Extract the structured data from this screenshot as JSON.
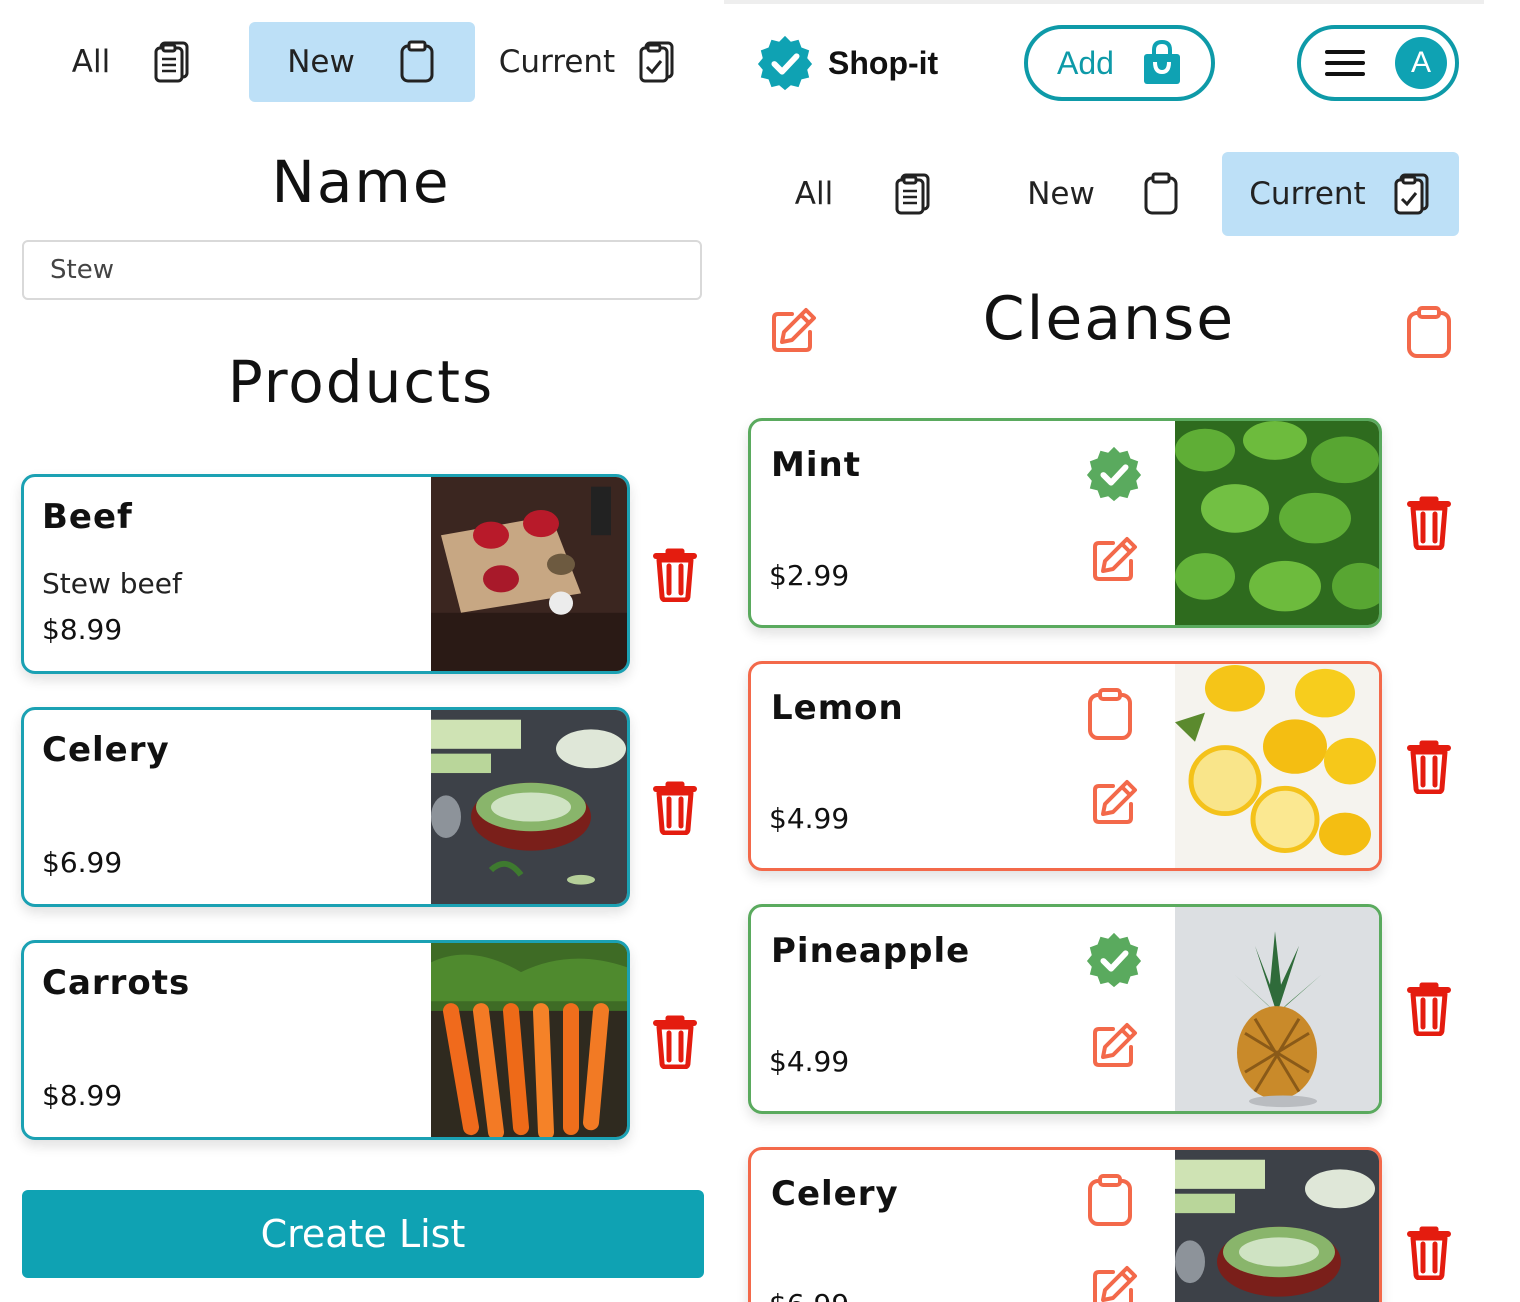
{
  "left": {
    "tabs": [
      {
        "label": "All",
        "icon": "clipboard-list-icon",
        "active": false
      },
      {
        "label": "New",
        "icon": "clipboard-icon",
        "active": true
      },
      {
        "label": "Current",
        "icon": "clipboard-check-icon",
        "active": false
      }
    ],
    "name_heading": "Name",
    "name_value": "Stew",
    "products_heading": "Products",
    "products": [
      {
        "title": "Beef",
        "description": "Stew beef",
        "price": "$8.99"
      },
      {
        "title": "Celery",
        "description": "",
        "price": "$6.99"
      },
      {
        "title": "Carrots",
        "description": "",
        "price": "$8.99"
      }
    ],
    "create_button": "Create List"
  },
  "right": {
    "brand": "Shop-it",
    "add_button": "Add",
    "avatar_letter": "A",
    "tabs": [
      {
        "label": "All",
        "icon": "clipboard-list-icon",
        "active": false
      },
      {
        "label": "New",
        "icon": "clipboard-icon",
        "active": false
      },
      {
        "label": "Current",
        "icon": "clipboard-check-icon",
        "active": true
      }
    ],
    "list_title": "Cleanse",
    "items": [
      {
        "title": "Mint",
        "price": "$2.99",
        "status": "checked"
      },
      {
        "title": "Lemon",
        "price": "$4.99",
        "status": "unchecked"
      },
      {
        "title": "Pineapple",
        "price": "$4.99",
        "status": "checked"
      },
      {
        "title": "Celery",
        "price": "$6.99",
        "status": "unchecked"
      }
    ]
  },
  "colors": {
    "teal": "#0fa2b3",
    "tab_active": "#bde0f7",
    "checked_green": "#5aaa5e",
    "unchecked_orange": "#f3694a",
    "trash_red": "#e41c0f"
  }
}
